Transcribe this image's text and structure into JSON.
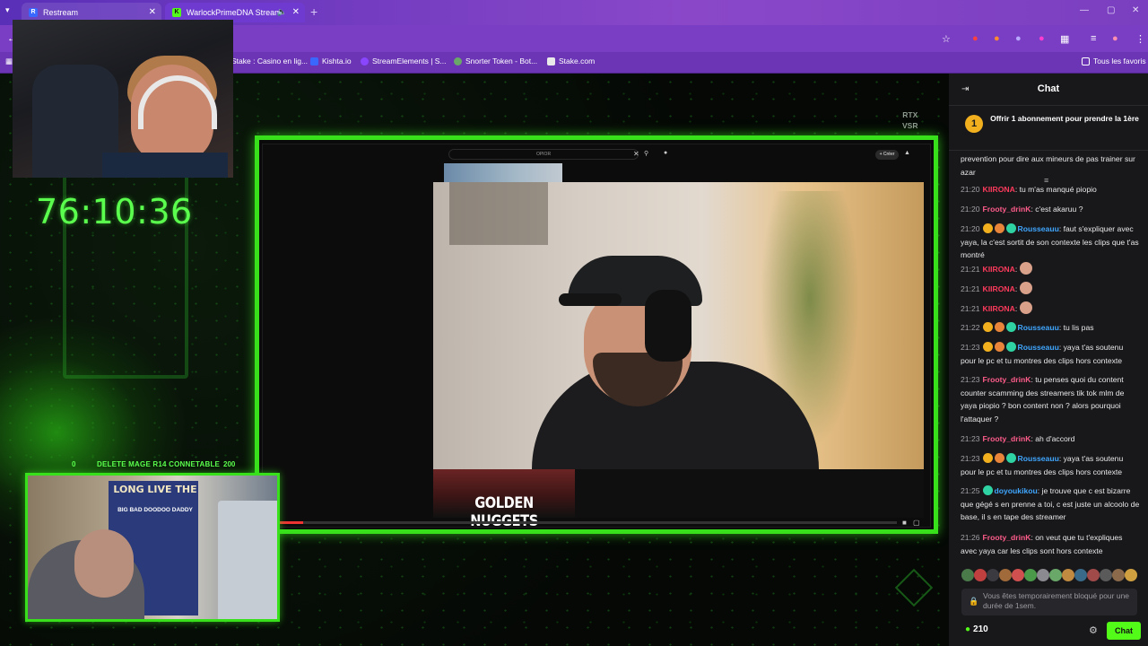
{
  "browser": {
    "tabs": [
      {
        "label": "Restream",
        "favicon": "R",
        "color": "#3a68ff"
      },
      {
        "label": "WarlockPrimeDNA Stream",
        "favicon": "K",
        "color": "#53fc18"
      }
    ],
    "bookmarks": [
      {
        "label": "Stake : Casino en lig...",
        "color": "#2a3b4c"
      },
      {
        "label": "Kishta.io",
        "color": "#3a68ff"
      },
      {
        "label": "StreamElements | S...",
        "color": "#8a46ff"
      },
      {
        "label": "Snorter Token - Bot...",
        "color": "#6aa86a"
      },
      {
        "label": "Stake.com",
        "color": "#0f212e"
      }
    ],
    "all_bookmarks_label": "Tous les favoris"
  },
  "overlay": {
    "timer": "76:10:36",
    "rtx_line1": "RTX",
    "rtx_line2": "VSR",
    "donation_left": "0",
    "donation_text": "DELETE MAGE R14 CONNETABLE",
    "donation_right": "200",
    "poster_title": "LONG LIVE THE",
    "poster_subtitle": "BIG BAD DOODOO DADDY"
  },
  "screen": {
    "search_placeholder": "OPIOR",
    "create_button": "+ Créer",
    "recommendation_title": "GOLDEN NUGGETS"
  },
  "chat": {
    "title": "Chat",
    "promo_badge": "1",
    "promo_text": "Offrir 1 abonnement pour prendre la 1ère",
    "messages": [
      {
        "time": "",
        "user": "",
        "color": "#ffffff",
        "badges": [],
        "text": "prevention pour dire aux mineurs de pas trainer sur azar",
        "emotes": 0
      },
      {
        "time": "21:20",
        "user": "KIIRONA",
        "color": "#ff3b5c",
        "badges": [],
        "text": "tu m'as manqué piopio",
        "emotes": 0
      },
      {
        "time": "21:20",
        "user": "Frooty_drinK",
        "color": "#ff5c8a",
        "badges": [],
        "text": "c'est akaruu ?",
        "emotes": 0
      },
      {
        "time": "21:20",
        "user": "Rousseauu",
        "color": "#3fa7ff",
        "badges": [
          "sub",
          "og",
          "gift"
        ],
        "text": "faut s'expliquer avec yaya, la c'est sortit de son contexte les clips que t'as montré",
        "emotes": 0
      },
      {
        "time": "21:21",
        "user": "KIIRONA",
        "color": "#ff3b5c",
        "badges": [],
        "text": "",
        "emotes": 1
      },
      {
        "time": "21:21",
        "user": "KIIRONA",
        "color": "#ff3b5c",
        "badges": [],
        "text": "",
        "emotes": 1
      },
      {
        "time": "21:21",
        "user": "KIIRONA",
        "color": "#ff3b5c",
        "badges": [],
        "text": "",
        "emotes": 1
      },
      {
        "time": "21:22",
        "user": "Rousseauu",
        "color": "#3fa7ff",
        "badges": [
          "sub",
          "og",
          "gift"
        ],
        "text": "tu lis pas",
        "emotes": 0
      },
      {
        "time": "21:23",
        "user": "Rousseauu",
        "color": "#3fa7ff",
        "badges": [
          "sub",
          "og",
          "gift"
        ],
        "text": "yaya t'as soutenu pour le pc et tu montres des clips hors contexte",
        "emotes": 0
      },
      {
        "time": "21:23",
        "user": "Frooty_drinK",
        "color": "#ff5c8a",
        "badges": [],
        "text": "tu penses quoi du content counter scamming des streamers tik tok mlm de yaya piopio ? bon content non ? alors pourquoi l'attaquer ?",
        "emotes": 0
      },
      {
        "time": "21:23",
        "user": "Frooty_drinK",
        "color": "#ff5c8a",
        "badges": [],
        "text": "ah d'accord",
        "emotes": 0
      },
      {
        "time": "21:23",
        "user": "Rousseauu",
        "color": "#3fa7ff",
        "badges": [
          "sub",
          "og",
          "gift"
        ],
        "text": "yaya t'as soutenu pour le pc et tu montres des clips hors contexte",
        "emotes": 0
      },
      {
        "time": "21:25",
        "user": "doyoukikou",
        "color": "#3fa7ff",
        "badges": [
          "mod"
        ],
        "text": "je trouve que c est bizarre que gégé s en prenne a toi, c est juste un alcoolo de base, il s en tape des streamer",
        "emotes": 0
      },
      {
        "time": "21:26",
        "user": "Frooty_drinK",
        "color": "#ff5c8a",
        "badges": [],
        "text": "on veut que tu t'expliques avec yaya car les clips sont hors contexte",
        "emotes": 0
      }
    ],
    "blocked_text": "Vous êtes temporairement bloqué pour une durée de 1sem.",
    "points": "210",
    "chat_button": "Chat",
    "accent": "#53fc18"
  }
}
